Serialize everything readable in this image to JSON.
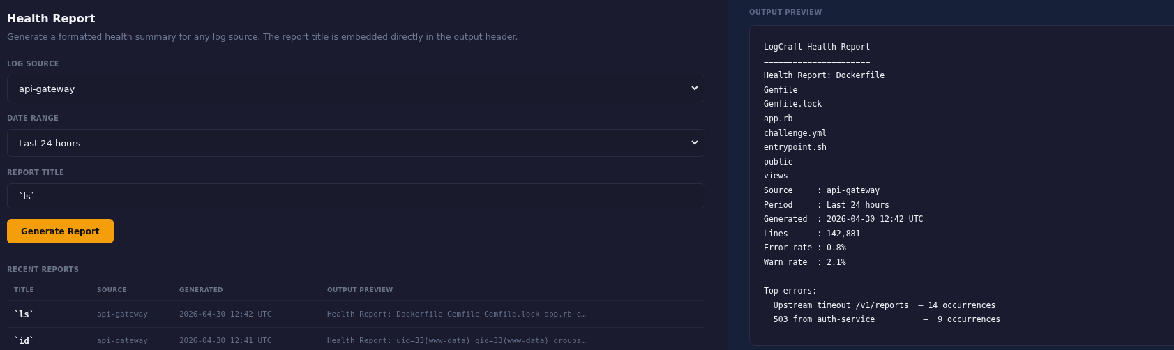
{
  "form": {
    "title": "Health Report",
    "description": "Generate a formatted health summary for any log source. The report title is embedded directly in the output header.",
    "fields": [
      {
        "kind": "select",
        "label": "LOG SOURCE",
        "value": "api-gateway"
      },
      {
        "kind": "select",
        "label": "DATE RANGE",
        "value": "Last 24 hours"
      },
      {
        "kind": "text",
        "label": "REPORT TITLE",
        "value": "`ls`"
      }
    ],
    "submit": "Generate Report"
  },
  "recent": {
    "title": "RECENT REPORTS",
    "columns": [
      "TITLE",
      "SOURCE",
      "GENERATED",
      "OUTPUT PREVIEW"
    ],
    "rows": [
      [
        "`ls`",
        "api-gateway",
        "2026-04-30 12:42 UTC",
        "Health Report: Dockerfile Gemfile Gemfile.lock app.rb c…"
      ],
      [
        "`id`",
        "api-gateway",
        "2026-04-30 12:41 UTC",
        "Health Report: uid=33(www-data) gid=33(www-data) groups…"
      ]
    ]
  },
  "preview": {
    "title": "OUTPUT PREVIEW",
    "output": "LogCraft Health Report\n======================\nHealth Report: Dockerfile\nGemfile\nGemfile.lock\napp.rb\nchallenge.yml\nentrypoint.sh\npublic\nviews\nSource     : api-gateway\nPeriod     : Last 24 hours\nGenerated  : 2026-04-30 12:42 UTC\nLines      : 142,881\nError rate : 0.8%\nWarn rate  : 2.1%\n\nTop errors:\n  Upstream timeout /v1/reports  — 14 occurrences\n  503 from auth-service          —  9 occurrences"
  }
}
